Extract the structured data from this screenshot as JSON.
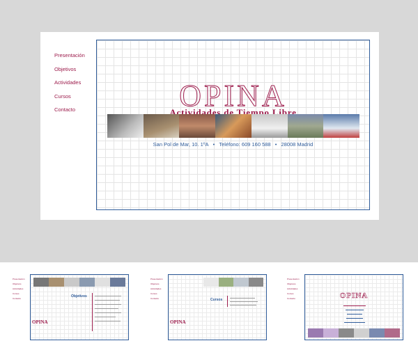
{
  "nav": {
    "items": [
      {
        "label": "Presentación"
      },
      {
        "label": "Objetivos"
      },
      {
        "label": "Actividades"
      },
      {
        "label": "Cursos"
      },
      {
        "label": "Contacto"
      }
    ]
  },
  "brand": {
    "logo": "OPINA",
    "tagline": "Actividades de Tiempo Libre"
  },
  "contact": {
    "address": "San Pol de Mar, 10. 1ºA",
    "phone": "Teléfono: 609 160 588",
    "city": "28008 Madrid",
    "separator": "•"
  },
  "thumbs": [
    {
      "section": "Objetivos"
    },
    {
      "section": "Cursos"
    },
    {
      "section": ""
    }
  ],
  "colors": {
    "accent": "#9c1b4b",
    "frame": "#2f5c9a",
    "background": "#d8d8d8"
  }
}
